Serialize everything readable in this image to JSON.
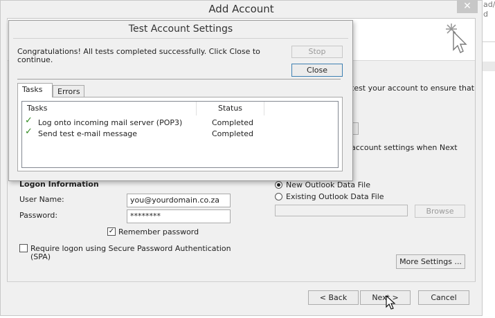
{
  "background": {
    "edge_text": "ad/\nd"
  },
  "dialog": {
    "title": "Add Account",
    "close_icon": "close-icon",
    "wizard_icon": "cursor-sparkle-icon",
    "right_text_1": "test your account to ensure that",
    "right_text_2": "account settings when Next",
    "logon_heading": "Logon Information",
    "username_label": "User Name:",
    "username_value": "you@yourdomain.co.za",
    "password_label": "Password:",
    "password_value": "********",
    "remember_label": "Remember password",
    "remember_checked": true,
    "spa_label_1": "Require logon using Secure Password Authentication",
    "spa_label_2": "(SPA)",
    "spa_checked": false,
    "new_datafile_label": "New Outlook Data File",
    "existing_datafile_label": "Existing Outlook Data File",
    "browse_label": "Browse",
    "more_settings_label": "More Settings ...",
    "back_label": "< Back",
    "next_label": "Next >",
    "cancel_label": "Cancel"
  },
  "popup": {
    "title": "Test Account Settings",
    "message_1": "Congratulations! All tests completed successfully. Click Close to",
    "message_2": "continue.",
    "stop_label": "Stop",
    "close_label": "Close",
    "tabs": [
      "Tasks",
      "Errors"
    ],
    "active_tab": "Tasks",
    "columns": [
      "Tasks",
      "Status"
    ],
    "rows": [
      {
        "task": "Log onto incoming mail server (POP3)",
        "status": "Completed",
        "icon": "check-icon"
      },
      {
        "task": "Send test e-mail message",
        "status": "Completed",
        "icon": "check-icon"
      }
    ]
  }
}
